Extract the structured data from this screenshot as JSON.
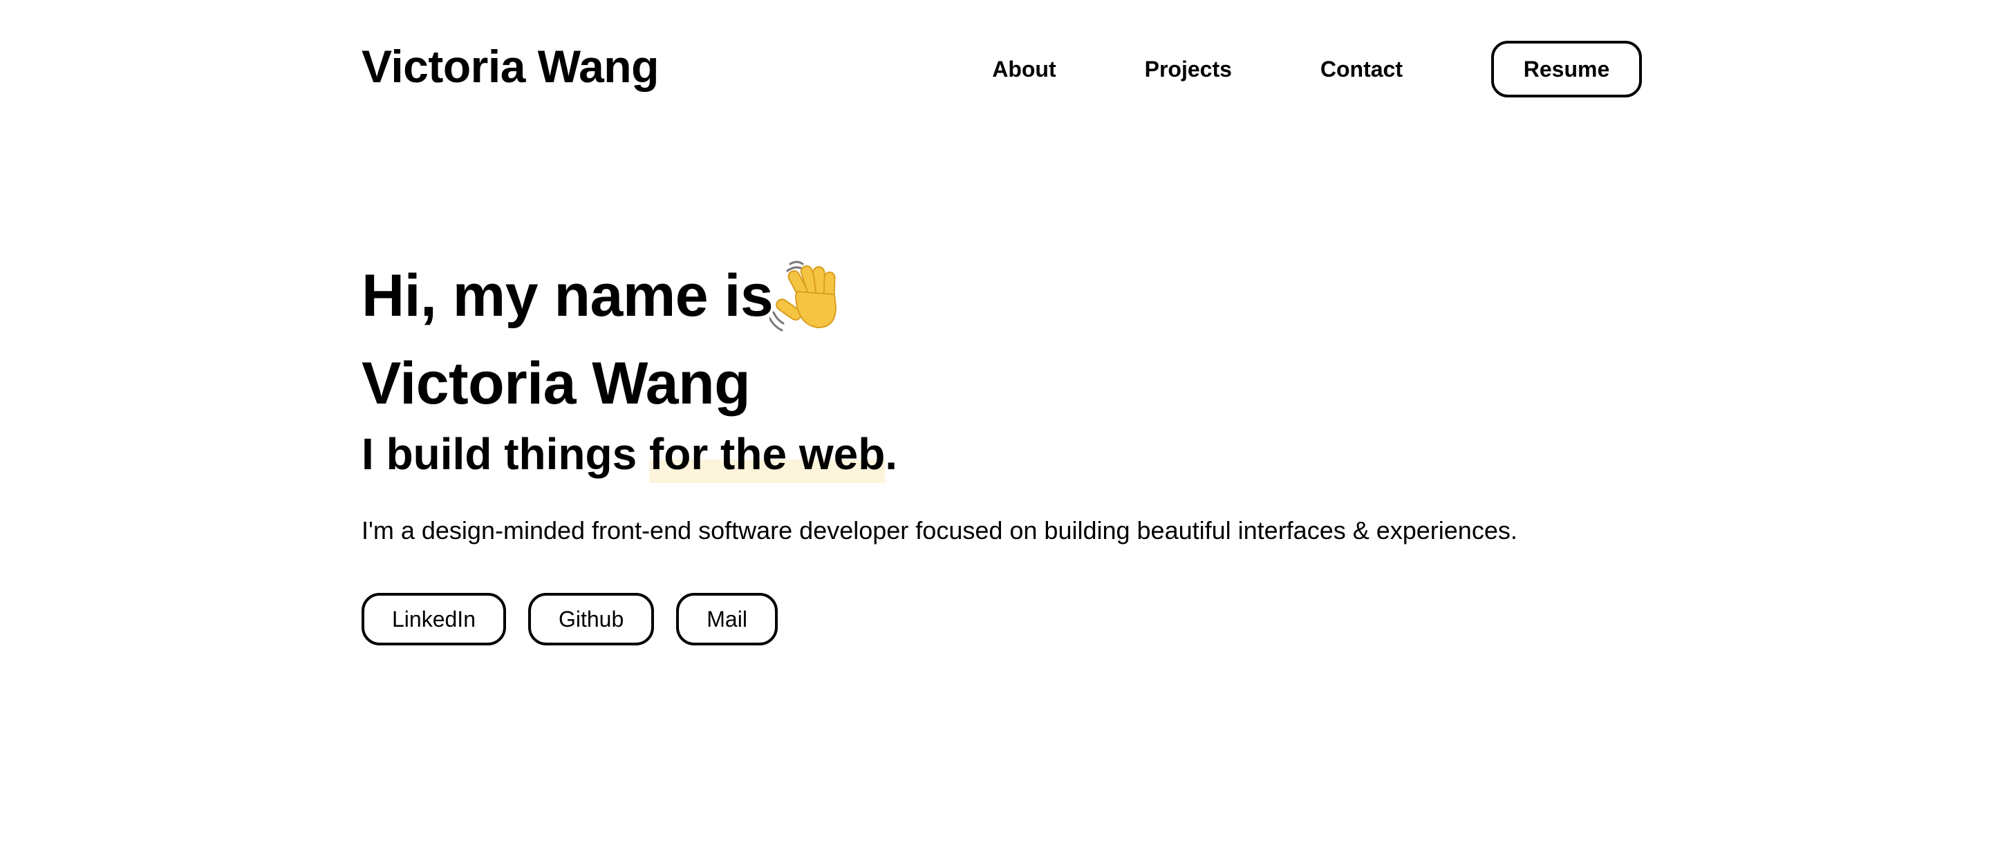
{
  "header": {
    "logo": "Victoria Wang",
    "nav": {
      "about": "About",
      "projects": "Projects",
      "contact": "Contact",
      "resume": "Resume"
    }
  },
  "hero": {
    "greeting": "Hi, my name is",
    "greeting_icon": "waving-hand-icon",
    "name": "Victoria Wang",
    "tagline_prefix": "I build things ",
    "tagline_highlight": "for the web",
    "tagline_suffix": ".",
    "bio": "I'm a design-minded front-end software developer focused on building beautiful interfaces & experiences.",
    "links": {
      "linkedin": "LinkedIn",
      "github": "Github",
      "mail": "Mail"
    }
  },
  "colors": {
    "text": "#000000",
    "background": "#ffffff",
    "highlight": "#fdf4dc",
    "wave_hand": "#f6c443"
  }
}
